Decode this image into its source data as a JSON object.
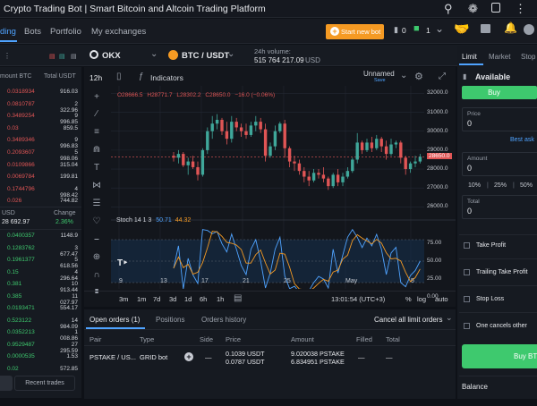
{
  "window_title": "Crypto Trading Bot | Smart Bitcoin and Altcoin Trading Platform",
  "nav": {
    "tabs": [
      "ding",
      "Bots",
      "Portfolio",
      "My exchanges"
    ],
    "start_label": "Start new bot",
    "bots_count": "0",
    "active_count": "1"
  },
  "header": {
    "exchange": "OKX",
    "pair": "BTC / USDT",
    "volume_label": "24h volume:",
    "volume_value": "515 764 217.09",
    "volume_unit": "USD"
  },
  "toolbar": {
    "interval": "12h",
    "indicators": "Indicators",
    "unnamed": "Unnamed",
    "save": "Save"
  },
  "ohlc": {
    "o": "O28666.5",
    "h": "H28771.7",
    "l": "L28302.2",
    "c": "C28650.0",
    "chg": "−16.0 (−0.06%)"
  },
  "price_axis": [
    "32000.0",
    "31000.0",
    "30000.0",
    "29000.0",
    "28650.0",
    "28000.0",
    "27000.0",
    "26000.0"
  ],
  "last_price": "28650.0",
  "stoch": {
    "label": "Stoch 14 1 3",
    "v1": "50.71",
    "v2": "44.32",
    "axis": [
      "75.00",
      "50.00",
      "25.00",
      "0.00"
    ]
  },
  "time_axis": [
    "9",
    "13",
    "17",
    "21",
    "25",
    "May",
    "5"
  ],
  "ranges": [
    "3m",
    "1m",
    "7d",
    "3d",
    "1d",
    "6h",
    "1h"
  ],
  "clock": "13:01:54 (UTC+3)",
  "scale_opts": [
    "%",
    "log",
    "auto"
  ],
  "orderbook": {
    "col1": "mount BTC",
    "col2": "Total USDT",
    "asks": [
      [
        "0.0318934",
        "916.03"
      ],
      [
        "0.0810787",
        "2 322.96"
      ],
      [
        "0.3489254",
        "9 996.85"
      ],
      [
        "0.03",
        "859.5"
      ],
      [
        "0.3489346",
        "9 996.83"
      ],
      [
        "0.2093607",
        "5 998.06"
      ],
      [
        "0.0109866",
        "315.04"
      ],
      [
        "0.0069784",
        "199.81"
      ],
      [
        "0.1744796",
        "4 998.42"
      ],
      [
        "0.026",
        "744.82"
      ]
    ],
    "mid_label": "USD",
    "mid_value": "28 692.97",
    "change_label": "Change",
    "change_value": "2.36%",
    "bids": [
      [
        "0.0400357",
        "1148.9"
      ],
      [
        "0.1283762",
        "3 677.47"
      ],
      [
        "0.1961377",
        "5 618.56"
      ],
      [
        "0.15",
        "4 296.64"
      ],
      [
        "0.381",
        "10 913.44"
      ],
      [
        "0.385",
        "11 027.97"
      ],
      [
        "0.0193471",
        "554.17"
      ],
      [
        "0.523122",
        "14 984.09"
      ],
      [
        "0.0352213",
        "1 008.86"
      ],
      [
        "0.9529487",
        "27 295.59"
      ],
      [
        "0.0000535",
        "1.53"
      ],
      [
        "0.02",
        "572.85"
      ]
    ],
    "recent": "Recent trades"
  },
  "orders": {
    "tabs": [
      "Open orders (1)",
      "Positions",
      "Orders history"
    ],
    "cancel": "Cancel all limit orders",
    "cols": [
      "Pair",
      "Type",
      "Side",
      "Price",
      "Amount",
      "Filled",
      "Total"
    ],
    "row": {
      "pair": "PSTAKE / US...",
      "type": "GRID bot",
      "price1": "0.1039 USDT",
      "price2": "0.0787 USDT",
      "amt1": "9.020038 PSTAKE",
      "amt2": "6.834951 PSTAKE",
      "filled": "—",
      "total": "—"
    }
  },
  "trade": {
    "tabs": [
      "Limit",
      "Market",
      "Stop"
    ],
    "available": "Available",
    "buy": "Buy",
    "price_label": "Price",
    "price_val": "0",
    "best": "Best ask",
    "amount_label": "Amount",
    "amount_val": "0",
    "pcts": [
      "10%",
      "25%",
      "50%"
    ],
    "total_label": "Total",
    "total_val": "0",
    "opts": [
      "Take Profit",
      "Trailing Take Profit",
      "Stop Loss",
      "One cancels other"
    ],
    "buy_btc": "Buy BTC",
    "balance": "Balance"
  },
  "colors": {
    "up": "#3fa79a",
    "down": "#e05555",
    "accent": "#4fa3ff",
    "orange": "#f59a23",
    "green": "#3ec96e"
  },
  "chart_data": {
    "type": "candlestick",
    "ylim": [
      25500,
      32300
    ],
    "candles": [
      [
        28700,
        28900,
        28400,
        28600
      ],
      [
        28600,
        29000,
        28300,
        28800
      ],
      [
        28800,
        28900,
        28100,
        28200
      ],
      [
        28200,
        28600,
        27700,
        28400
      ],
      [
        28400,
        28700,
        28000,
        28100
      ],
      [
        28100,
        28400,
        27400,
        27700
      ],
      [
        27700,
        29100,
        27600,
        29000
      ],
      [
        29000,
        30200,
        28800,
        30000
      ],
      [
        30000,
        30800,
        29600,
        30400
      ],
      [
        30400,
        30900,
        30100,
        30600
      ],
      [
        30600,
        30700,
        29800,
        30000
      ],
      [
        30000,
        30500,
        29300,
        29600
      ],
      [
        29600,
        30800,
        29400,
        30500
      ],
      [
        30500,
        30700,
        30000,
        30200
      ],
      [
        30200,
        30400,
        29700,
        30000
      ],
      [
        30000,
        30400,
        29600,
        29800
      ],
      [
        29800,
        30500,
        29700,
        30300
      ],
      [
        30300,
        30800,
        30000,
        30500
      ],
      [
        30500,
        30700,
        29900,
        30100
      ],
      [
        30100,
        30400,
        28400,
        28700
      ],
      [
        28700,
        29400,
        28600,
        29200
      ],
      [
        29200,
        30300,
        29000,
        30000
      ],
      [
        30000,
        30500,
        29900,
        30400
      ],
      [
        30400,
        30600,
        28600,
        29100
      ],
      [
        29100,
        29200,
        28100,
        28400
      ],
      [
        28400,
        28700,
        27900,
        28300
      ],
      [
        28300,
        28500,
        27700,
        27900
      ],
      [
        27900,
        28100,
        27300,
        27600
      ],
      [
        27600,
        27900,
        27100,
        27400
      ],
      [
        27400,
        28000,
        27300,
        27800
      ],
      [
        27800,
        28000,
        27500,
        27700
      ],
      [
        27700,
        28100,
        27300,
        27500
      ],
      [
        27500,
        27600,
        26900,
        27100
      ],
      [
        27100,
        27800,
        27000,
        27700
      ],
      [
        27700,
        28000,
        27100,
        27300
      ],
      [
        27300,
        27800,
        27100,
        27600
      ],
      [
        27600,
        28100,
        27500,
        27900
      ],
      [
        27900,
        28600,
        27800,
        28500
      ],
      [
        28500,
        29900,
        28300,
        29400
      ],
      [
        29400,
        29500,
        28800,
        29000
      ],
      [
        29000,
        29600,
        28900,
        29400
      ],
      [
        29400,
        29700,
        28900,
        29100
      ],
      [
        29100,
        29800,
        29000,
        29600
      ],
      [
        29600,
        29700,
        28900,
        29200
      ],
      [
        29200,
        29500,
        28500,
        28800
      ],
      [
        28800,
        29600,
        28700,
        29300
      ],
      [
        29300,
        29500,
        29100,
        29400
      ],
      [
        29400,
        29500,
        28300,
        28600
      ],
      [
        28600,
        28700,
        27700,
        28000
      ],
      [
        28000,
        28400,
        27800,
        28300
      ],
      [
        28300,
        28700,
        28100,
        28400
      ],
      [
        28400,
        28800,
        28300,
        28650
      ]
    ]
  }
}
